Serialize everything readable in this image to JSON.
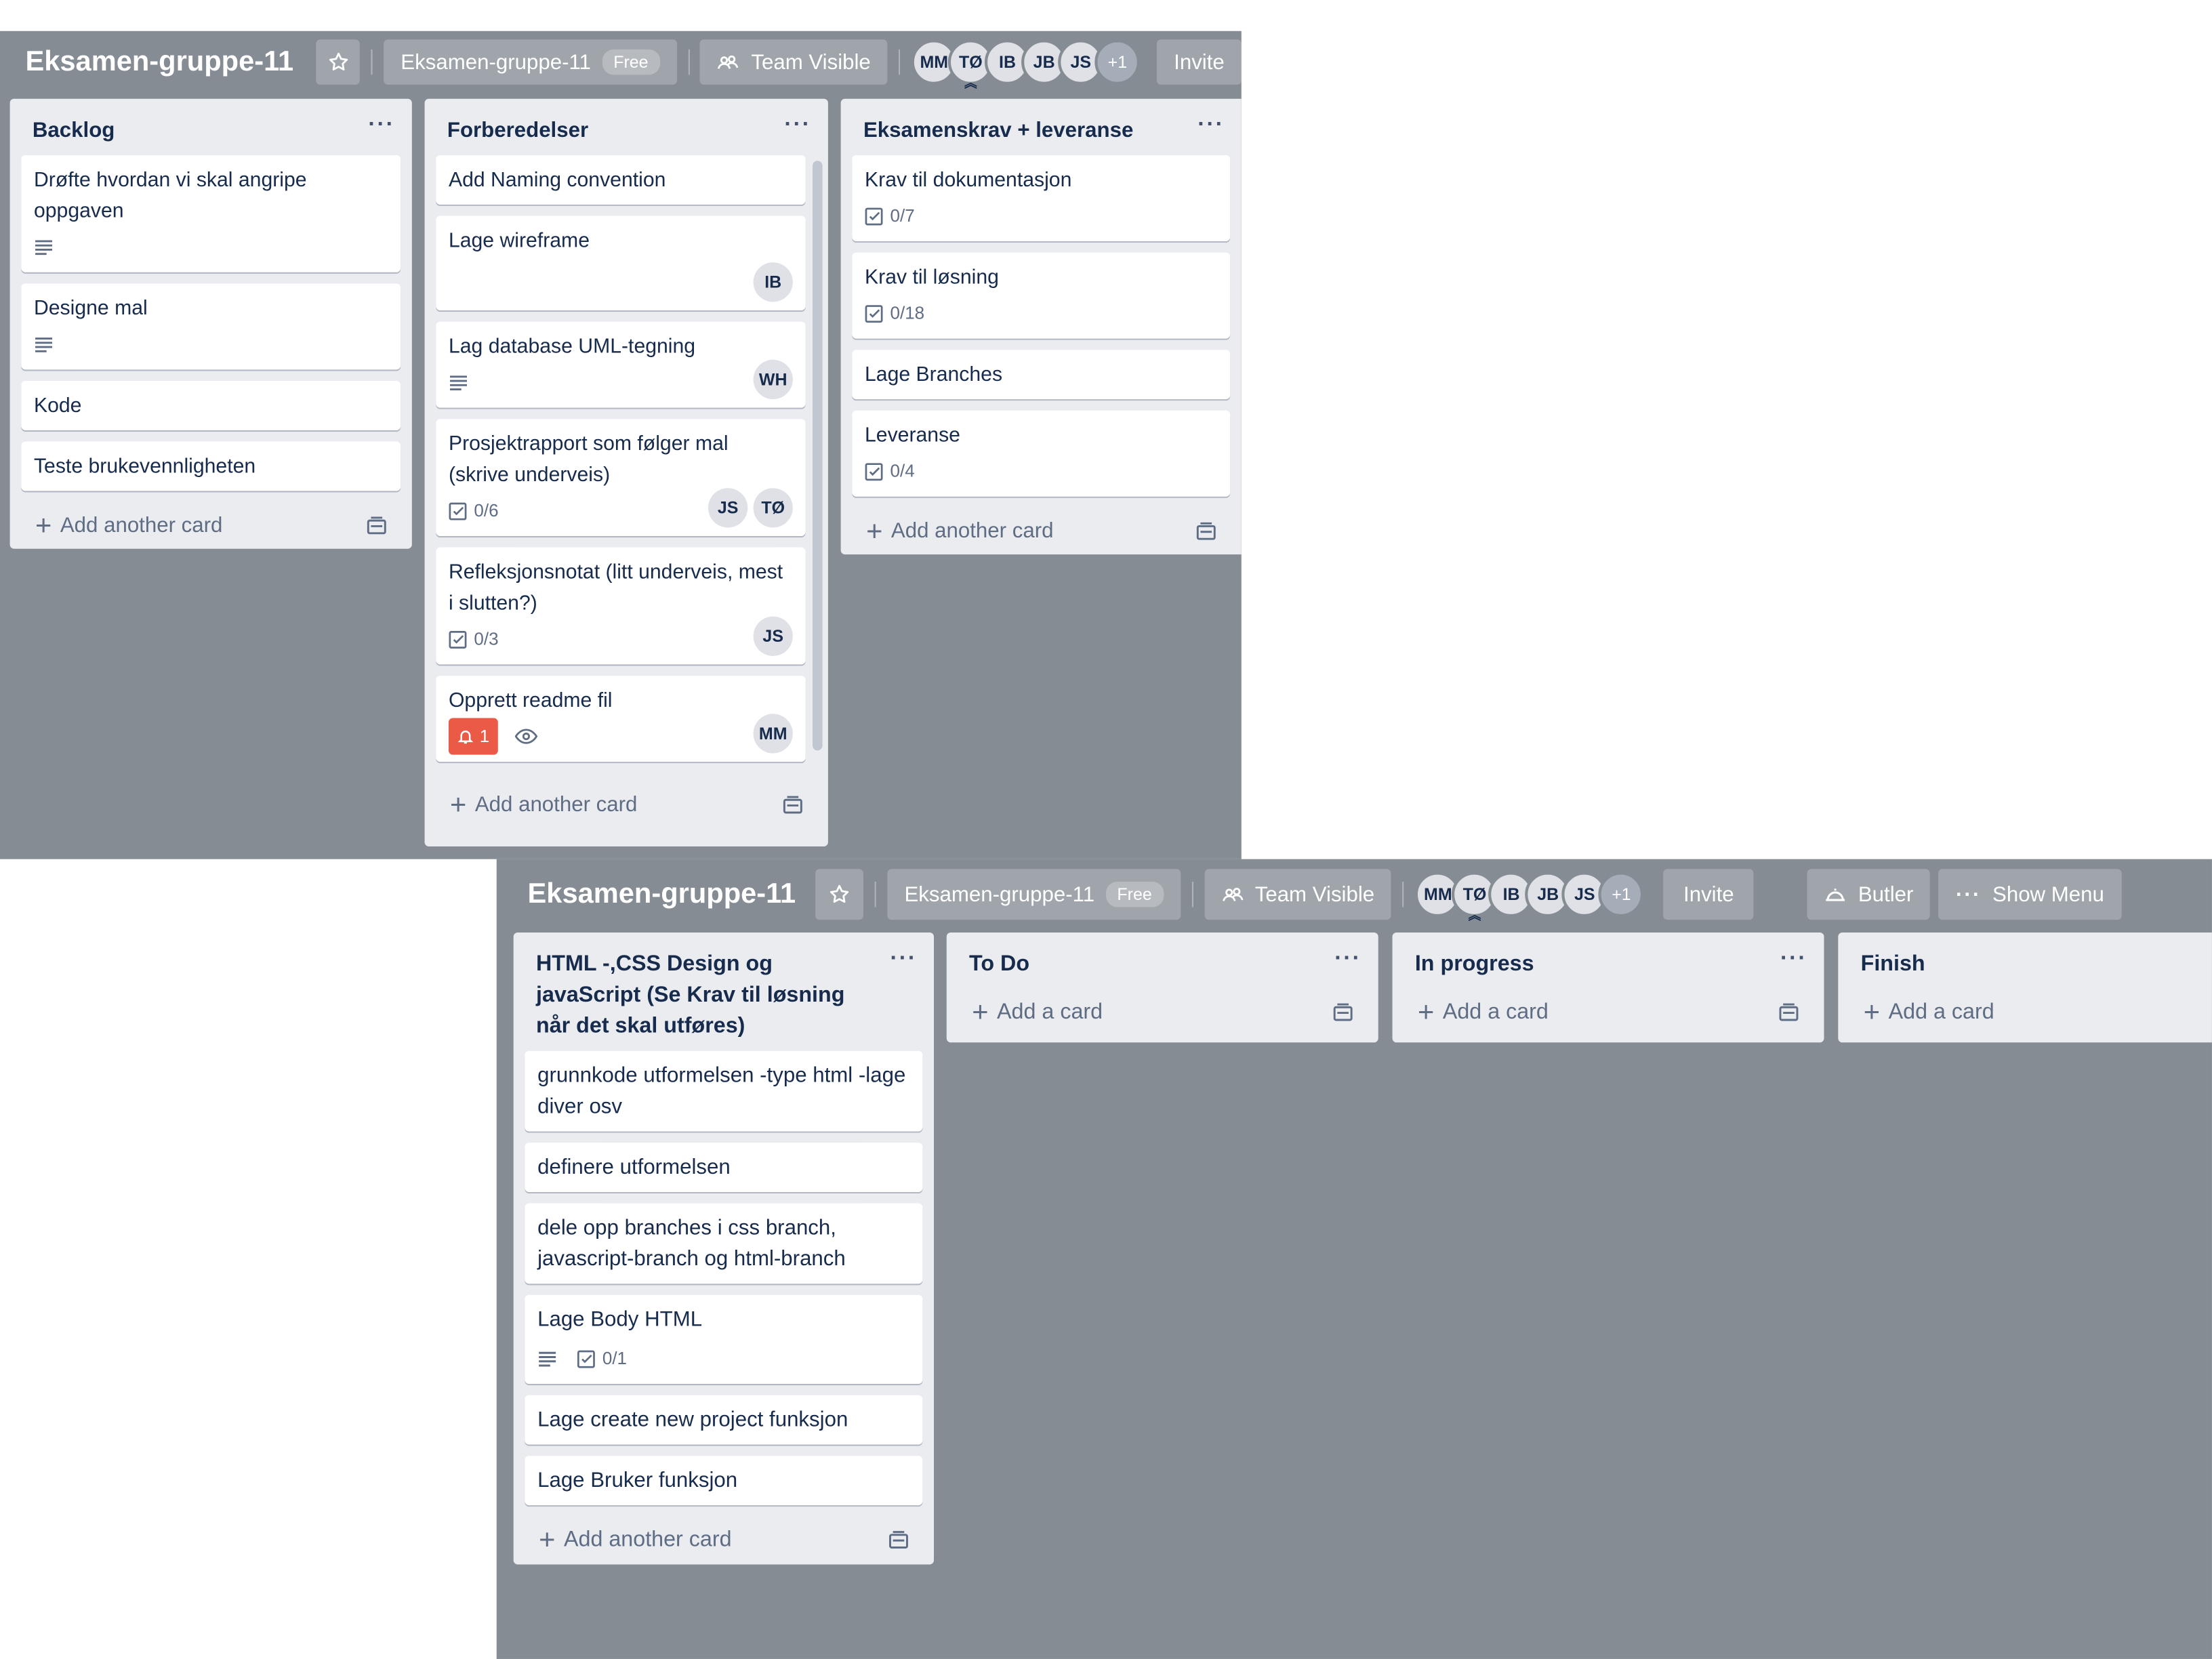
{
  "board_title": "Eksamen-gruppe-11",
  "header": {
    "team_label": "Eksamen-gruppe-11",
    "plan_badge": "Free",
    "visibility_label": "Team Visible",
    "members": [
      "MM",
      "TØ",
      "IB",
      "JB",
      "JS"
    ],
    "extra_members": "+1",
    "invite_label": "Invite",
    "butler_label": "Butler",
    "menu_label": "Show Menu"
  },
  "colors": {
    "board_bg": "#858c94",
    "list_bg": "#ebecf0",
    "label_red": "#eb5a46"
  },
  "top_lists": {
    "backlog": {
      "title": "Backlog",
      "cards": [
        "Drøfte hvordan vi skal angripe oppgaven",
        "Designe mal",
        "Kode",
        "Teste brukevennligheten"
      ],
      "add_label": "Add another card"
    },
    "forberedelser": {
      "title": "Forberedelser",
      "cards": [
        {
          "title": "Add Naming convention"
        },
        {
          "title": "Lage wireframe",
          "members": [
            "IB"
          ]
        },
        {
          "title": "Lag database UML-tegning",
          "members": [
            "WH"
          ]
        },
        {
          "title": "Prosjektrapport som følger mal (skrive underveis)",
          "checklist": "0/6",
          "members": [
            "JS",
            "TØ"
          ]
        },
        {
          "title": "Refleksjonsnotat (litt underveis, mest i slutten?)",
          "checklist": "0/3",
          "members": [
            "JS"
          ]
        },
        {
          "title": "Opprett readme fil",
          "notifications": "1",
          "members": [
            "MM"
          ]
        }
      ],
      "add_label": "Add another card"
    },
    "eksamenskrav": {
      "title": "Eksamenskrav + leveranse",
      "cards": [
        {
          "title": "Krav til dokumentasjon",
          "checklist": "0/7"
        },
        {
          "title": "Krav til løsning",
          "checklist": "0/18"
        },
        {
          "title": "Lage Branches"
        },
        {
          "title": "Leveranse",
          "checklist": "0/4"
        }
      ],
      "add_label": "Add another card"
    }
  },
  "bottom_lists": {
    "html": {
      "title": "HTML -,CSS Design og javaScript (Se Krav til løsning når det skal utføres)",
      "cards": [
        {
          "title": "grunnkode utformelsen -type html -lage diver osv"
        },
        {
          "title": "definere utformelsen"
        },
        {
          "title": "dele opp branches i css branch, javascript-branch og html-branch"
        },
        {
          "title": "Lage Body HTML",
          "checklist": "0/1"
        },
        {
          "title": "Lage create new project funksjon"
        },
        {
          "title": "Lage Bruker funksjon"
        }
      ],
      "add_label": "Add another card"
    },
    "todo": {
      "title": "To Do",
      "add_label": "Add a card"
    },
    "inprogress": {
      "title": "In progress",
      "add_label": "Add a card"
    },
    "finish": {
      "title": "Finish",
      "add_label": "Add a card"
    }
  }
}
